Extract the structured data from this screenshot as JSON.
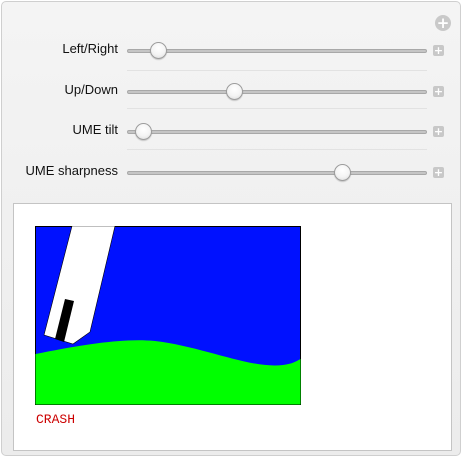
{
  "controls": [
    {
      "label": "Left/Right",
      "value": 0.08
    },
    {
      "label": "Up/Down",
      "value": 0.35
    },
    {
      "label": "UME tilt",
      "value": 0.03
    },
    {
      "label": "UME sharpness",
      "value": 0.73
    }
  ],
  "output": {
    "status": "CRASH",
    "status_color": "#cc0000",
    "sky_color": "#0011ff",
    "ground_color": "#00ff00",
    "probe_color": "#ffffff",
    "probe_tip_color": "#000000"
  },
  "icons": {
    "panel_expand": "plus-circle-icon",
    "control_expand": "plus-square-icon"
  }
}
